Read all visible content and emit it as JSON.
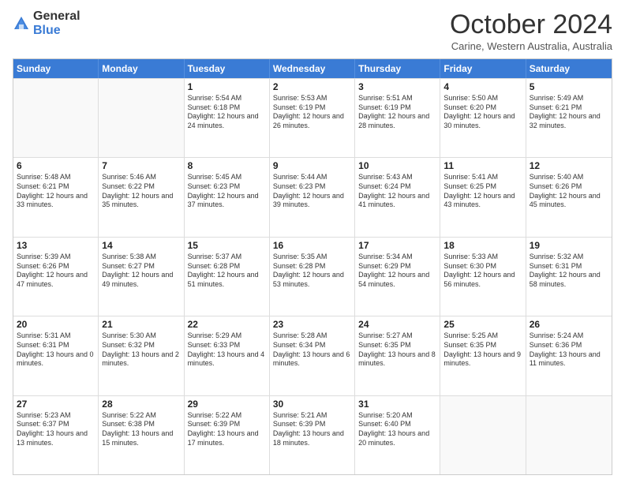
{
  "logo": {
    "general": "General",
    "blue": "Blue"
  },
  "header": {
    "month": "October 2024",
    "location": "Carine, Western Australia, Australia"
  },
  "days": [
    "Sunday",
    "Monday",
    "Tuesday",
    "Wednesday",
    "Thursday",
    "Friday",
    "Saturday"
  ],
  "rows": [
    [
      {
        "day": "",
        "empty": true
      },
      {
        "day": "",
        "empty": true
      },
      {
        "day": "1",
        "sunrise": "Sunrise: 5:54 AM",
        "sunset": "Sunset: 6:18 PM",
        "daylight": "Daylight: 12 hours and 24 minutes."
      },
      {
        "day": "2",
        "sunrise": "Sunrise: 5:53 AM",
        "sunset": "Sunset: 6:19 PM",
        "daylight": "Daylight: 12 hours and 26 minutes."
      },
      {
        "day": "3",
        "sunrise": "Sunrise: 5:51 AM",
        "sunset": "Sunset: 6:19 PM",
        "daylight": "Daylight: 12 hours and 28 minutes."
      },
      {
        "day": "4",
        "sunrise": "Sunrise: 5:50 AM",
        "sunset": "Sunset: 6:20 PM",
        "daylight": "Daylight: 12 hours and 30 minutes."
      },
      {
        "day": "5",
        "sunrise": "Sunrise: 5:49 AM",
        "sunset": "Sunset: 6:21 PM",
        "daylight": "Daylight: 12 hours and 32 minutes."
      }
    ],
    [
      {
        "day": "6",
        "sunrise": "Sunrise: 5:48 AM",
        "sunset": "Sunset: 6:21 PM",
        "daylight": "Daylight: 12 hours and 33 minutes."
      },
      {
        "day": "7",
        "sunrise": "Sunrise: 5:46 AM",
        "sunset": "Sunset: 6:22 PM",
        "daylight": "Daylight: 12 hours and 35 minutes."
      },
      {
        "day": "8",
        "sunrise": "Sunrise: 5:45 AM",
        "sunset": "Sunset: 6:23 PM",
        "daylight": "Daylight: 12 hours and 37 minutes."
      },
      {
        "day": "9",
        "sunrise": "Sunrise: 5:44 AM",
        "sunset": "Sunset: 6:23 PM",
        "daylight": "Daylight: 12 hours and 39 minutes."
      },
      {
        "day": "10",
        "sunrise": "Sunrise: 5:43 AM",
        "sunset": "Sunset: 6:24 PM",
        "daylight": "Daylight: 12 hours and 41 minutes."
      },
      {
        "day": "11",
        "sunrise": "Sunrise: 5:41 AM",
        "sunset": "Sunset: 6:25 PM",
        "daylight": "Daylight: 12 hours and 43 minutes."
      },
      {
        "day": "12",
        "sunrise": "Sunrise: 5:40 AM",
        "sunset": "Sunset: 6:26 PM",
        "daylight": "Daylight: 12 hours and 45 minutes."
      }
    ],
    [
      {
        "day": "13",
        "sunrise": "Sunrise: 5:39 AM",
        "sunset": "Sunset: 6:26 PM",
        "daylight": "Daylight: 12 hours and 47 minutes."
      },
      {
        "day": "14",
        "sunrise": "Sunrise: 5:38 AM",
        "sunset": "Sunset: 6:27 PM",
        "daylight": "Daylight: 12 hours and 49 minutes."
      },
      {
        "day": "15",
        "sunrise": "Sunrise: 5:37 AM",
        "sunset": "Sunset: 6:28 PM",
        "daylight": "Daylight: 12 hours and 51 minutes."
      },
      {
        "day": "16",
        "sunrise": "Sunrise: 5:35 AM",
        "sunset": "Sunset: 6:28 PM",
        "daylight": "Daylight: 12 hours and 53 minutes."
      },
      {
        "day": "17",
        "sunrise": "Sunrise: 5:34 AM",
        "sunset": "Sunset: 6:29 PM",
        "daylight": "Daylight: 12 hours and 54 minutes."
      },
      {
        "day": "18",
        "sunrise": "Sunrise: 5:33 AM",
        "sunset": "Sunset: 6:30 PM",
        "daylight": "Daylight: 12 hours and 56 minutes."
      },
      {
        "day": "19",
        "sunrise": "Sunrise: 5:32 AM",
        "sunset": "Sunset: 6:31 PM",
        "daylight": "Daylight: 12 hours and 58 minutes."
      }
    ],
    [
      {
        "day": "20",
        "sunrise": "Sunrise: 5:31 AM",
        "sunset": "Sunset: 6:31 PM",
        "daylight": "Daylight: 13 hours and 0 minutes."
      },
      {
        "day": "21",
        "sunrise": "Sunrise: 5:30 AM",
        "sunset": "Sunset: 6:32 PM",
        "daylight": "Daylight: 13 hours and 2 minutes."
      },
      {
        "day": "22",
        "sunrise": "Sunrise: 5:29 AM",
        "sunset": "Sunset: 6:33 PM",
        "daylight": "Daylight: 13 hours and 4 minutes."
      },
      {
        "day": "23",
        "sunrise": "Sunrise: 5:28 AM",
        "sunset": "Sunset: 6:34 PM",
        "daylight": "Daylight: 13 hours and 6 minutes."
      },
      {
        "day": "24",
        "sunrise": "Sunrise: 5:27 AM",
        "sunset": "Sunset: 6:35 PM",
        "daylight": "Daylight: 13 hours and 8 minutes."
      },
      {
        "day": "25",
        "sunrise": "Sunrise: 5:25 AM",
        "sunset": "Sunset: 6:35 PM",
        "daylight": "Daylight: 13 hours and 9 minutes."
      },
      {
        "day": "26",
        "sunrise": "Sunrise: 5:24 AM",
        "sunset": "Sunset: 6:36 PM",
        "daylight": "Daylight: 13 hours and 11 minutes."
      }
    ],
    [
      {
        "day": "27",
        "sunrise": "Sunrise: 5:23 AM",
        "sunset": "Sunset: 6:37 PM",
        "daylight": "Daylight: 13 hours and 13 minutes."
      },
      {
        "day": "28",
        "sunrise": "Sunrise: 5:22 AM",
        "sunset": "Sunset: 6:38 PM",
        "daylight": "Daylight: 13 hours and 15 minutes."
      },
      {
        "day": "29",
        "sunrise": "Sunrise: 5:22 AM",
        "sunset": "Sunset: 6:39 PM",
        "daylight": "Daylight: 13 hours and 17 minutes."
      },
      {
        "day": "30",
        "sunrise": "Sunrise: 5:21 AM",
        "sunset": "Sunset: 6:39 PM",
        "daylight": "Daylight: 13 hours and 18 minutes."
      },
      {
        "day": "31",
        "sunrise": "Sunrise: 5:20 AM",
        "sunset": "Sunset: 6:40 PM",
        "daylight": "Daylight: 13 hours and 20 minutes."
      },
      {
        "day": "",
        "empty": true
      },
      {
        "day": "",
        "empty": true
      }
    ]
  ]
}
